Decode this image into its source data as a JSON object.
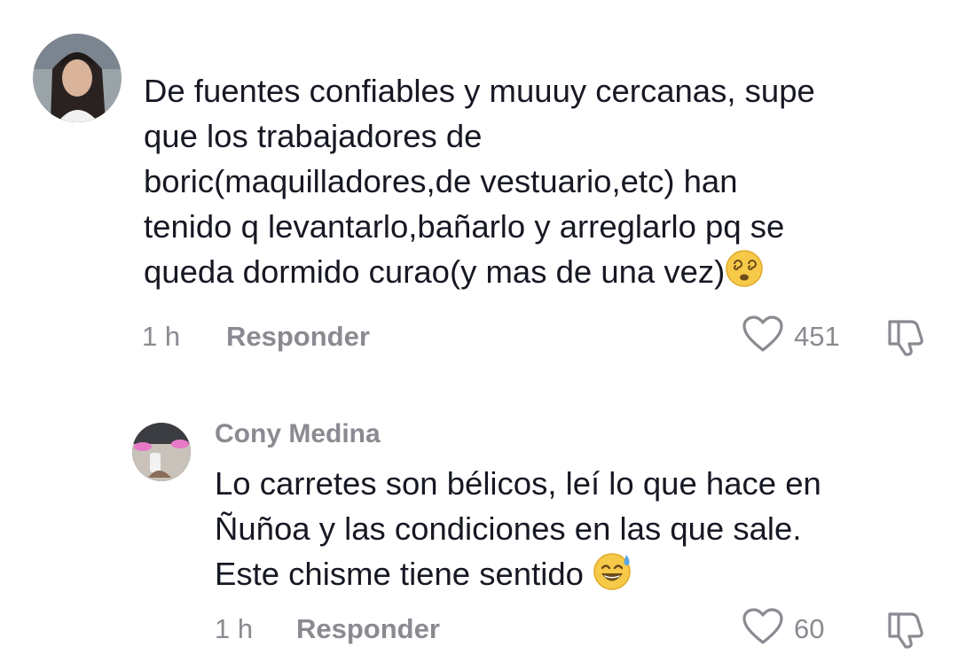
{
  "comments": [
    {
      "author": "",
      "avatar": "user-avatar",
      "text_lines": [
        "De fuentes confiables y muuuy cercanas, supe",
        "que los trabajadores de",
        "boric(maquilladores,de vestuario,etc) han",
        "tenido q levantarlo,bañarlo y arreglarlo pq se",
        "queda dormido curao(y mas de una vez)"
      ],
      "emoji": "dizzy-face-emoji",
      "time": "1 h",
      "reply_label": "Responder",
      "likes": "451"
    },
    {
      "author": "Cony Medina",
      "avatar": "user-avatar",
      "text_lines": [
        "Lo carretes son bélicos, leí lo que hace en",
        "Ñuñoa y las condiciones en las que sale.",
        "Este chisme tiene sentido"
      ],
      "emoji": "grinning-sweat-emoji",
      "time": "1 h",
      "reply_label": "Responder",
      "likes": "60"
    }
  ],
  "colors": {
    "text": "#161823",
    "muted": "#8a8b91",
    "emoji": "#f7c948"
  }
}
